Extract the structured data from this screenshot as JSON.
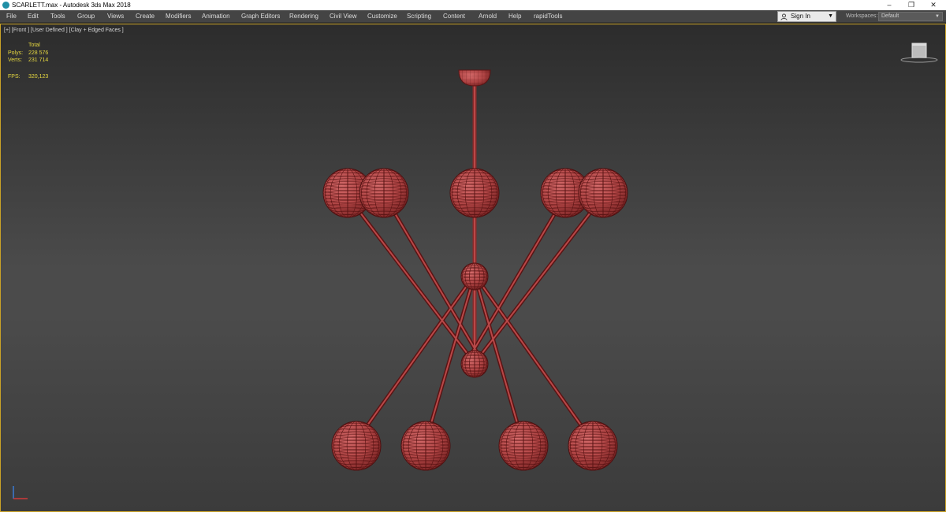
{
  "window": {
    "title": "SCARLETT.max - Autodesk 3ds Max 2018",
    "minimize": "–",
    "restore": "❐",
    "close": "✕"
  },
  "menu": [
    "File",
    "Edit",
    "Tools",
    "Group",
    "Views",
    "Create",
    "Modifiers",
    "Animation",
    "Graph Editors",
    "Rendering",
    "Civil View",
    "Customize",
    "Scripting",
    "Content",
    "Arnold",
    "Help",
    "rapidTools"
  ],
  "signin": {
    "label": "Sign In",
    "caret": "▼"
  },
  "workspaces": {
    "label": "Workspaces:",
    "value": "Default",
    "caret": "▼"
  },
  "viewport": {
    "label": "[+] [Front ] [User Defined ] [Clay + Edged Faces ]",
    "stats": {
      "header": "Total",
      "polys_label": "Polys:",
      "polys": "228 576",
      "verts_label": "Verts:",
      "verts": "231 714",
      "fps_label": "FPS:",
      "fps": "320,123"
    }
  },
  "colors": {
    "model": "#b84848",
    "wire": "#5a1414",
    "viewport_border": "#c9a227",
    "stats_text": "#e6d840"
  }
}
